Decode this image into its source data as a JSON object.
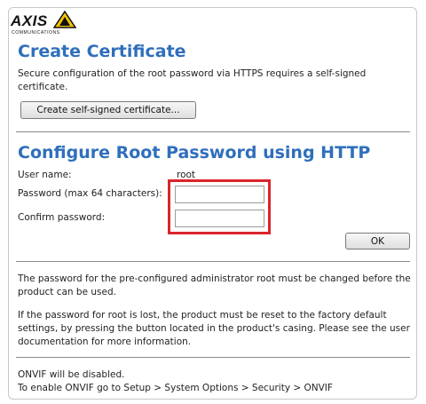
{
  "logo": {
    "brand": "AXIS",
    "tagline": "COMMUNICATIONS"
  },
  "create_certificate": {
    "title": "Create Certificate",
    "description": "Secure configuration of the root password via HTTPS requires a self-signed certificate.",
    "button_label": "Create self-signed certificate..."
  },
  "configure_password": {
    "title": "Configure Root Password using HTTP",
    "username_label": "User name:",
    "username_value": "root",
    "password_label": "Password (max 64 characters):",
    "password_value": "",
    "confirm_label": "Confirm password:",
    "confirm_value": "",
    "ok_label": "OK"
  },
  "notes": {
    "must_change": "The password for the pre-configured administrator root must be changed before the product can be used.",
    "lost_password": "If the password for root is lost, the product must be reset to the factory default settings, by pressing the button located in the product's casing. Please see the user documentation for more information."
  },
  "onvif": {
    "disabled_text": "ONVIF will be disabled.",
    "enable_hint": "To enable ONVIF go to Setup > System Options > Security > ONVIF"
  },
  "colors": {
    "title": "#2f6fbc",
    "highlight": "#d9252b",
    "logo_yellow": "#f5c400"
  }
}
